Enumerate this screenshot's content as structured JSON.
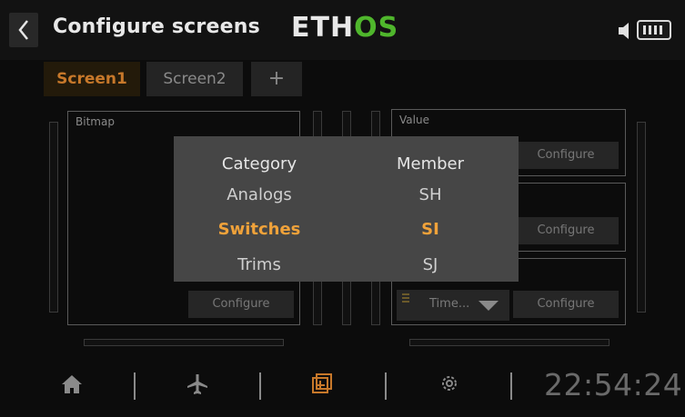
{
  "header": {
    "title": "Configure screens",
    "logo_part1": "ETH",
    "logo_part2": "OS"
  },
  "tabs": [
    {
      "label": "Screen1",
      "active": true
    },
    {
      "label": "Screen2",
      "active": false
    },
    {
      "label": "+",
      "active": false
    }
  ],
  "widgets": {
    "left": {
      "label": "Bitmap",
      "configure": "Configure"
    },
    "right_top": {
      "label": "Value",
      "configure": "Configure"
    },
    "right_mid": {
      "configure": "Configure"
    },
    "right_bottom": {
      "dropdown_value": "Time...",
      "configure": "Configure"
    }
  },
  "modal": {
    "category_header": "Category",
    "member_header": "Member",
    "categories": [
      "Analogs",
      "Switches",
      "Trims"
    ],
    "members": [
      "SH",
      "SI",
      "SJ"
    ],
    "selected_index": 1
  },
  "bottom_nav": {
    "icons": [
      "home-icon",
      "airplane-icon",
      "screens-icon",
      "gear-icon"
    ],
    "clock": "22:54:24"
  },
  "colors": {
    "accent": "#f0a23a",
    "logo_green": "#4fb62c",
    "tab_active": "#c7782a"
  }
}
